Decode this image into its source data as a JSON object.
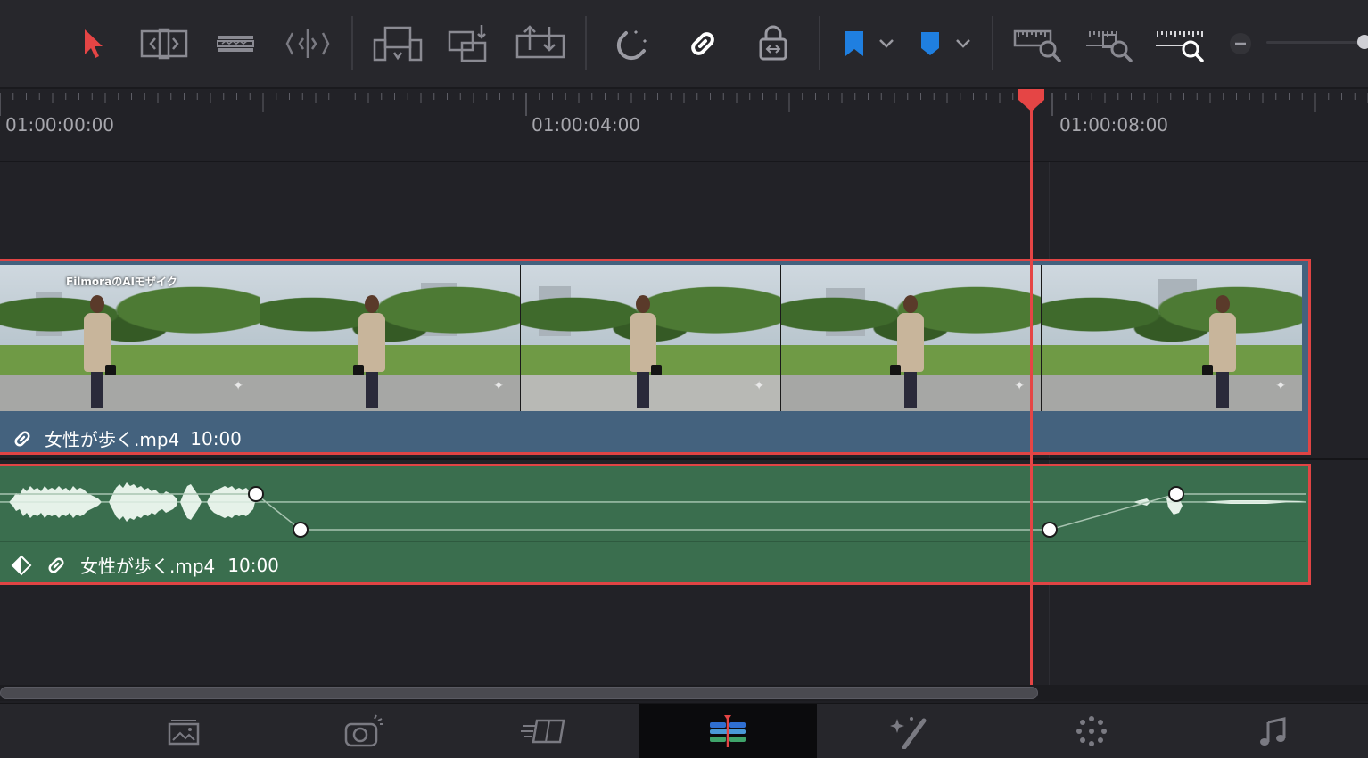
{
  "toolbar": {
    "tools": [
      {
        "name": "selection-mode",
        "icon": "arrow-pointer-icon",
        "active": true
      },
      {
        "name": "trim-edit-mode",
        "icon": "trim-icon"
      },
      {
        "name": "blade-edit-mode",
        "icon": "blade-icon"
      },
      {
        "name": "dynamic-trim-mode",
        "icon": "dynamic-trim-icon"
      },
      {
        "name": "insert-clip",
        "icon": "insert-clip-icon"
      },
      {
        "name": "overwrite-clip",
        "icon": "overwrite-clip-icon"
      },
      {
        "name": "replace-clip",
        "icon": "replace-clip-icon"
      },
      {
        "name": "snapping",
        "icon": "magnet-icon"
      },
      {
        "name": "linked-selection",
        "icon": "link-icon",
        "active": true
      },
      {
        "name": "position-lock",
        "icon": "lock-icon"
      },
      {
        "name": "flag",
        "icon": "flag-icon"
      },
      {
        "name": "marker",
        "icon": "marker-icon"
      },
      {
        "name": "full-extent-zoom",
        "icon": "zoom-full-icon"
      },
      {
        "name": "detail-zoom",
        "icon": "zoom-detail-icon"
      },
      {
        "name": "custom-zoom",
        "icon": "zoom-custom-icon"
      }
    ],
    "zoom_level": 0.9,
    "colors": {
      "accent_red": "#e54545",
      "flag_blue": "#1f7fe0",
      "marker_blue": "#1f7fe0"
    }
  },
  "ruler": {
    "timecodes": [
      "01:00:00:00",
      "01:00:04:00",
      "01:00:08:00"
    ]
  },
  "video_track": {
    "overlay_text": "FilmoraのAIモザイク",
    "clip_name": "女性が歩く.mp4",
    "clip_duration": "10:00",
    "sparkle": "✦"
  },
  "audio_track": {
    "clip_name": "女性が歩く.mp4",
    "clip_duration": "10:00"
  },
  "page_tabs": [
    {
      "name": "media",
      "icon": "media-icon"
    },
    {
      "name": "cut",
      "icon": "cut-icon"
    },
    {
      "name": "edit",
      "icon": "edit-icon"
    },
    {
      "name": "timeline",
      "icon": "timeline-icon",
      "active": true
    },
    {
      "name": "fusion",
      "icon": "fusion-icon"
    },
    {
      "name": "color",
      "icon": "color-icon"
    },
    {
      "name": "fairlight",
      "icon": "fairlight-icon"
    }
  ]
}
